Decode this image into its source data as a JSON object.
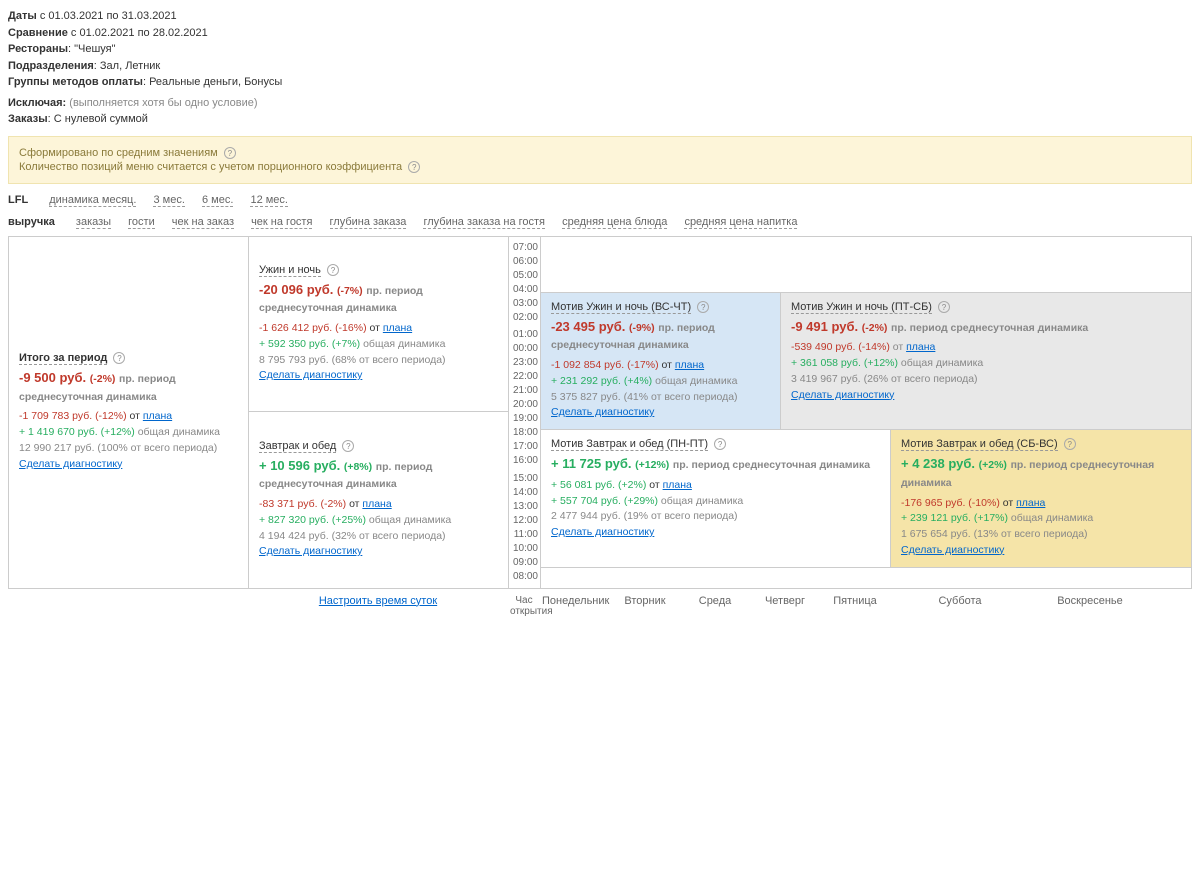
{
  "header": {
    "dates_lbl": "Даты",
    "dates_val": "с 01.03.2021 по 31.03.2021",
    "compare_lbl": "Сравнение",
    "compare_val": "с 01.02.2021 по 28.02.2021",
    "rest_lbl": "Рестораны",
    "rest_val": ": \"Чешуя\"",
    "dept_lbl": "Подразделения",
    "dept_val": ": Зал, Летник",
    "pay_lbl": "Группы методов оплаты",
    "pay_val": ": Реальные деньги, Бонусы",
    "excl_lbl": "Исключая:",
    "excl_val": "(выполняется хотя бы одно условие)",
    "orders_lbl": "Заказы",
    "orders_val": ": С нулевой суммой"
  },
  "banner": {
    "l1": "Сформировано по средним значениям",
    "l2": "Количество позиций меню считается с учетом порционного коэффициента"
  },
  "tabs1": {
    "lbl": "LFL",
    "items": [
      "динамика месяц.",
      "3 мес.",
      "6 мес.",
      "12 мес."
    ]
  },
  "tabs2": {
    "lbl": "выручка",
    "items": [
      "заказы",
      "гости",
      "чек на заказ",
      "чек на гостя",
      "глубина заказа",
      "глубина заказа на гостя",
      "средняя цена блюда",
      "средняя цена напитка"
    ]
  },
  "times_top": [
    "07:00",
    "06:00",
    "05:00",
    "04:00",
    "03:00",
    "02:00"
  ],
  "times_mid": [
    "01:00",
    "00:00",
    "23:00",
    "22:00",
    "21:00",
    "20:00",
    "19:00",
    "18:00",
    "17:00",
    "16:00"
  ],
  "times_bot": [
    "15:00",
    "14:00",
    "13:00",
    "12:00",
    "11:00",
    "10:00",
    "09:00",
    "08:00"
  ],
  "total": {
    "title": "Итого за период",
    "v1": "-9 500 руб.",
    "v1p": "(-2%)",
    "v1t": "пр. период среднесуточная динамика",
    "l1": "-1 709 783 руб. (-12%)",
    "l1t": "от",
    "l1link": "плана",
    "l2": "+ 1 419 670 руб. (+12%)",
    "l2t": "общая динамика",
    "l3": "12 990 217 руб. (100% от всего периода)",
    "diag": "Сделать диагностику"
  },
  "dinner": {
    "title": "Ужин и ночь",
    "v1": "-20 096 руб.",
    "v1p": "(-7%)",
    "v1t": "пр. период среднесуточная динамика",
    "l1": "-1 626 412 руб. (-16%)",
    "l1t": "от",
    "l1link": "плана",
    "l2": "+ 592 350 руб. (+7%)",
    "l2t": "общая динамика",
    "l3": "8 795 793 руб. (68% от всего периода)",
    "diag": "Сделать диагностику"
  },
  "lunch": {
    "title": "Завтрак и обед",
    "v1": "+ 10 596 руб.",
    "v1p": "(+8%)",
    "v1t": "пр. период среднесуточная динамика",
    "l1": "-83 371 руб. (-2%)",
    "l1t": "от",
    "l1link": "плана",
    "l2": "+ 827 320 руб. (+25%)",
    "l2t": "общая динамика",
    "l3": "4 194 424 руб. (32% от всего периода)",
    "diag": "Сделать диагностику"
  },
  "c1": {
    "title": "Мотив Ужин и ночь (ВС-ЧТ)",
    "v1": "-23 495 руб.",
    "v1p": "(-9%)",
    "v1t": "пр. период среднесуточная динамика",
    "l1": "-1 092 854 руб. (-17%)",
    "l1t": "от",
    "l1link": "плана",
    "l2": "+ 231 292 руб. (+4%)",
    "l2t": "общая динамика",
    "l3": "5 375 827 руб. (41% от всего периода)",
    "diag": "Сделать диагностику"
  },
  "c2": {
    "title": "Мотив Ужин и ночь (ПТ-СБ)",
    "v1": "-9 491 руб.",
    "v1p": "(-2%)",
    "v1t": "пр. период среднесуточная динамика",
    "l1": "-539 490 руб. (-14%)",
    "l1t": "от",
    "l1link": "плана",
    "l2": "+ 361 058 руб. (+12%)",
    "l2t": "общая динамика",
    "l3": "3 419 967 руб. (26% от всего периода)",
    "diag": "Сделать диагностику"
  },
  "c3": {
    "title": "Мотив Завтрак и обед (ПН-ПТ)",
    "v1": "+ 11 725 руб.",
    "v1p": "(+12%)",
    "v1t": "пр. период среднесуточная динамика",
    "l1": "+ 56 081 руб. (+2%)",
    "l1t": "от",
    "l1link": "плана",
    "l2": "+ 557 704 руб. (+29%)",
    "l2t": "общая динамика",
    "l3": "2 477 944 руб. (19% от всего периода)",
    "diag": "Сделать диагностику"
  },
  "c4": {
    "title": "Мотив Завтрак и обед (СБ-ВС)",
    "v1": "+ 4 238 руб.",
    "v1p": "(+2%)",
    "v1t": "пр. период среднесуточная динамика",
    "l1": "-176 965 руб. (-10%)",
    "l1t": "от",
    "l1link": "плана",
    "l2": "+ 239 121 руб. (+17%)",
    "l2t": "общая динамика",
    "l3": "1 675 654 руб. (13% от всего периода)",
    "diag": "Сделать диагностику"
  },
  "configure": "Настроить время суток",
  "axis": {
    "hour": "Час открытия",
    "days": [
      "Понедельник",
      "Вторник",
      "Среда",
      "Четверг",
      "Пятница",
      "Суббота",
      "Воскресенье"
    ]
  }
}
